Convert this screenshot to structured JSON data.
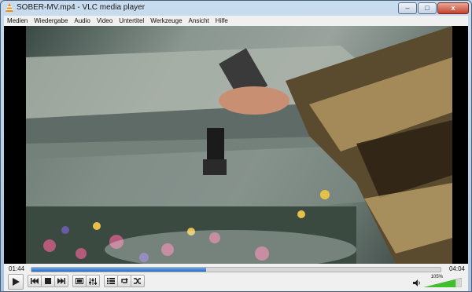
{
  "window": {
    "title": "SOBER-MV.mp4 - VLC media player",
    "controls": {
      "minimize_glyph": "–",
      "maximize_glyph": "□",
      "close_glyph": "x"
    }
  },
  "menu": [
    "Medien",
    "Wiedergabe",
    "Audio",
    "Video",
    "Untertitel",
    "Werkzeuge",
    "Ansicht",
    "Hilfe"
  ],
  "player": {
    "time_elapsed": "01:44",
    "time_total": "04:04",
    "progress_fraction": 0.426,
    "volume_label": "105%",
    "volume_fraction": 0.84
  },
  "icons": {
    "play": "play-icon",
    "prev": "previous-icon",
    "stop": "stop-icon",
    "next": "next-icon",
    "fullscreen": "fullscreen-icon",
    "extended": "extended-settings-icon",
    "playlist": "playlist-icon",
    "loop": "loop-icon",
    "shuffle": "shuffle-icon",
    "volume": "speaker-icon"
  },
  "colors": {
    "accent": "#2a6cc4",
    "volume_green": "#3fbf2a"
  }
}
